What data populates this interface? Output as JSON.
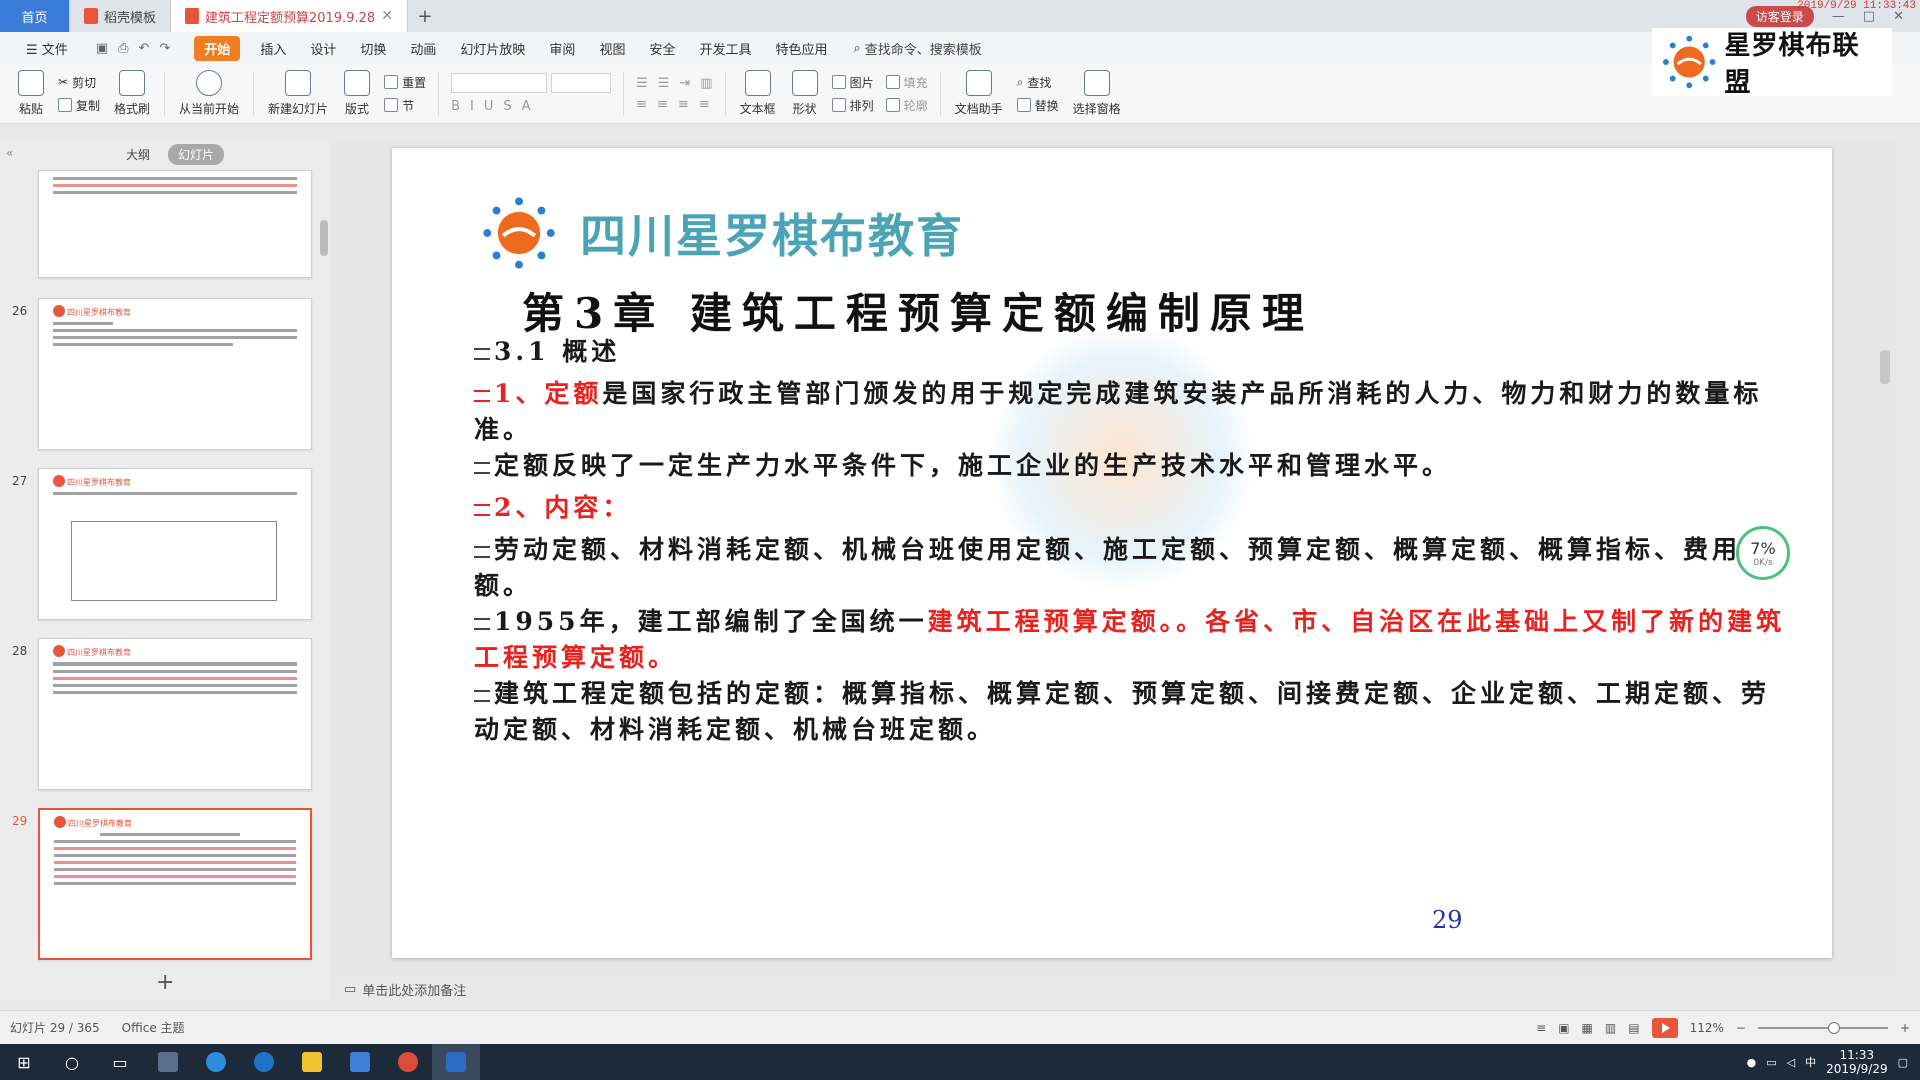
{
  "titlebar": {
    "tabs": [
      "首页",
      "稻壳模板",
      "建筑工程定额预算2019.9.28"
    ],
    "login": "访客登录",
    "clock": "2019/9/29 11:33:43"
  },
  "menu": {
    "file": "文件",
    "items": [
      "开始",
      "插入",
      "设计",
      "切换",
      "动画",
      "幻灯片放映",
      "审阅",
      "视图",
      "安全",
      "开发工具",
      "特色应用"
    ],
    "search": "查找命令、搜索模板"
  },
  "ribbon": {
    "paste": "粘贴",
    "cut": "剪切",
    "copy": "复制",
    "format_painter": "格式刷",
    "from_current": "从当前开始",
    "new_slide": "新建幻灯片",
    "layout": "版式",
    "reset": "重置",
    "section": "节",
    "textbox": "文本框",
    "shape": "形状",
    "picture": "图片",
    "arrange": "排列",
    "fill": "填充",
    "outline": "轮廓",
    "find": "查找",
    "replace": "替换",
    "doc_assistant": "文档助手",
    "selection_pane": "选择窗格"
  },
  "brand_logo": "星罗棋布联盟",
  "left_panel": {
    "tabs": [
      "大纲",
      "幻灯片"
    ],
    "thumbnails": [
      {
        "num": "",
        "title": ""
      },
      {
        "num": "26",
        "title": "四川星罗棋布教育"
      },
      {
        "num": "27",
        "title": "四川星罗棋布教育"
      },
      {
        "num": "28",
        "title": "四川星罗棋布教育"
      },
      {
        "num": "29",
        "title": "四川星罗棋布教育"
      }
    ],
    "add": "+"
  },
  "slide": {
    "brand": "四川星罗棋布教育",
    "title": "第3章  建筑工程预算定额编制原理",
    "section": "3.1  概述",
    "p1_red": "1、定额",
    "p1_rest": "是国家行政主管部门颁发的用于规定完成建筑安装产品所消耗的人力、物力和财力的数量标准。",
    "p2": "定额反映了一定生产力水平条件下，施工企业的生产技术水平和管理水平。",
    "p3_red": "2、内容：",
    "p4": "劳动定额、材料消耗定额、机械台班使用定额、施工定额、预算定额、概算定额、概算指标、费用定额。",
    "p5_black": "1955年，建工部编制了全国统一",
    "p5_red": "建筑工程预算定额。。各省、市、自治区在此基础上又制了新的建筑工程预算定额。",
    "p6": "建筑工程定额包括的定额：概算指标、概算定额、预算定额、间接费定额、企业定额、工期定额、劳动定额、材料消耗定额、机械台班定额。",
    "page_number": "29"
  },
  "speed_widget": {
    "percent": "7%",
    "rate": "0K/s"
  },
  "notes": "单击此处添加备注",
  "status": {
    "slide_count": "幻灯片 29 / 365",
    "theme": "Office 主题",
    "zoom": "112%"
  },
  "taskbar": {
    "time": "11:33",
    "date": "2019/9/29",
    "ime": "中"
  },
  "colors": {
    "accent": "#ef7d22",
    "slide_red": "#e8231f",
    "brand_teal": "#4ba3b6",
    "page_blue": "#2233aa"
  }
}
